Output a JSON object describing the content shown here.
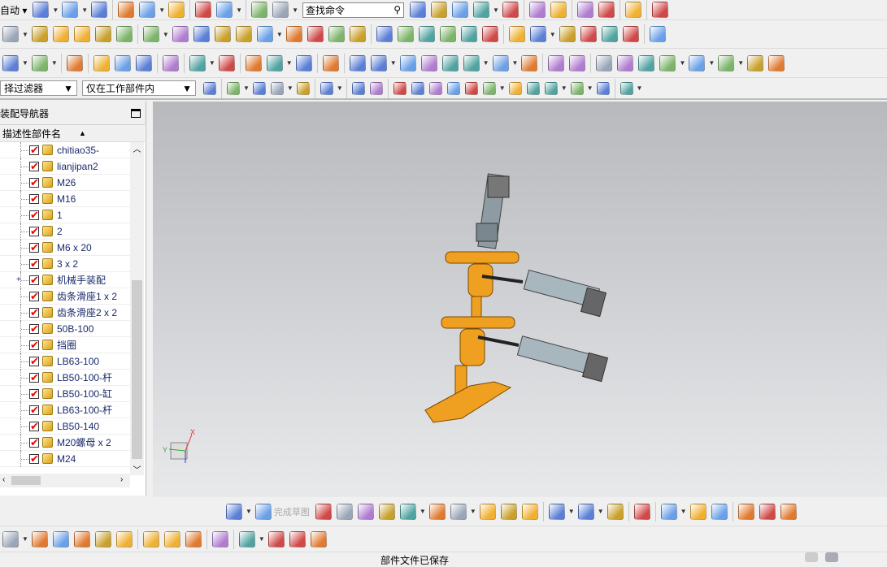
{
  "toolbar": {
    "auto_label": "自动",
    "search_placeholder": "查找命令",
    "row1": [
      "new-file-icon",
      "open-folder-icon",
      "save-icon",
      "|",
      "cut-icon",
      "copy-icon",
      "paste-icon",
      "|",
      "undo-icon",
      "redo-icon",
      "|",
      "save-dropdown-icon",
      "info-icon"
    ],
    "row1b": [
      "fit-view-icon",
      "render-style-icon",
      "shaded-cube-icon",
      "layer-icon",
      "background-icon",
      "|",
      "wcs-icon",
      "display-part-icon",
      "|",
      "assembly-list-icon",
      "measure-icon",
      "|",
      "analysis-icon",
      "|",
      "curve-point-icon"
    ],
    "row2": [
      "extrude-icon",
      "revolve-icon",
      "hole-icon",
      "boss-icon",
      "pad-icon",
      "shell-icon",
      "|",
      "offset-face-icon",
      "pattern-feature-icon",
      "pattern-geometry-icon",
      "split-body-icon",
      "unite-icon",
      "blend-icon",
      "chamfer-icon",
      "sweep-icon",
      "trim-body-icon",
      "draft-icon",
      "|",
      "block-icon",
      "ruled-surface-icon",
      "through-curves-icon",
      "styled-sweep-icon",
      "bounded-plane-icon",
      "cube-edit-icon",
      "|",
      "extension-icon",
      "law-surface-icon",
      "sew-icon",
      "offset-surface-icon",
      "edit-surface-icon",
      "x-form-icon",
      "|",
      "remove-params-icon"
    ],
    "row3": [
      "layers-icon",
      "layer-settings-icon",
      "|",
      "tag-icon",
      "|",
      "check-icon",
      "check-edit-icon",
      "check-body-icon",
      "|",
      "pmi-label-icon",
      "|",
      "wave-icon",
      "surface-icon",
      "|",
      "spring-icon",
      "coil-icon",
      "roll-icon",
      "|",
      "tools-icon",
      "|",
      "triangle-icon",
      "table-icon",
      "grid-add-icon",
      "parts-family-icon",
      "note-icon",
      "brush-icon",
      "dimension-icon",
      "tolerance-icon",
      "|",
      "assembly-add-icon",
      "assembly-new-icon",
      "|",
      "line-icon",
      "arc-icon",
      "spline-icon",
      "shape-icon",
      "plane-curve-icon",
      "project-curve-icon",
      "intersect-curve-icon",
      "wrap-icon"
    ],
    "filter_label": "择过滤器",
    "scope_label": "仅在工作部件内",
    "row4": [
      "filter-icon",
      "|",
      "undo-filter-icon",
      "point-filter-icon",
      "rotate-icon",
      "snap-icon",
      "|",
      "rect-select-icon",
      "|",
      "face-icon",
      "body-icon",
      "|",
      "snap-point-icon",
      "endpoint-icon",
      "midpoint-icon",
      "tangent-icon",
      "control-point-icon",
      "intersection-icon",
      "center-icon",
      "quadrant-icon",
      "existing-point-icon",
      "point-on-curve-icon",
      "point-on-face-icon",
      "|",
      "grid-icon"
    ]
  },
  "navigator": {
    "title": "装配导航器",
    "column": "描述性部件名",
    "items": [
      "chitiao35-",
      "lianjipan2",
      "M26",
      "M16",
      "1",
      "2",
      "M6 x 20",
      "3 x 2",
      "机械手装配",
      "齿条滑座1 x 2",
      "齿条滑座2 x 2",
      "50B-100",
      "挡圈",
      "LB63-100",
      "LB50-100-杆",
      "LB50-100-缸",
      "LB63-100-杆",
      "LB50-140",
      "M20螺母 x 2",
      "M24"
    ]
  },
  "sketch_toolbar": {
    "finish_label": "完成草图",
    "icons": [
      "sketch-icon",
      "finish-flag-icon",
      "profile-icon",
      "line-icon",
      "arc-icon",
      "circle-icon",
      "fillet-icon",
      "chamfer-icon",
      "rectangle-icon",
      "studio-spline-icon",
      "point-icon",
      "offset-curve-icon",
      "|",
      "quick-trim-icon",
      "quick-extend-icon",
      "make-corner-icon",
      "|",
      "geometric-constraint-icon",
      "|",
      "dimension-icon",
      "rapid-dimension-icon",
      "perpendicular-icon",
      "|",
      "auto-constrain-icon",
      "show-constraints-icon",
      "reattach-icon"
    ]
  },
  "assembly_toolbar": {
    "icons": [
      "assembly-icon",
      "component-icon",
      "add-component-icon",
      "move-component-icon",
      "constraint-icon",
      "mirror-icon",
      "|",
      "pattern-icon",
      "group-icon",
      "replace-icon",
      "|",
      "wave-link-icon",
      "|",
      "link-icon",
      "link-manager-icon",
      "relations-icon",
      "explode-icon"
    ]
  },
  "status": {
    "message": "部件文件已保存"
  },
  "colors": {
    "accent": "#f0a020",
    "viewport_top": "#b7b9bd",
    "viewport_bottom": "#e8e9eb"
  }
}
